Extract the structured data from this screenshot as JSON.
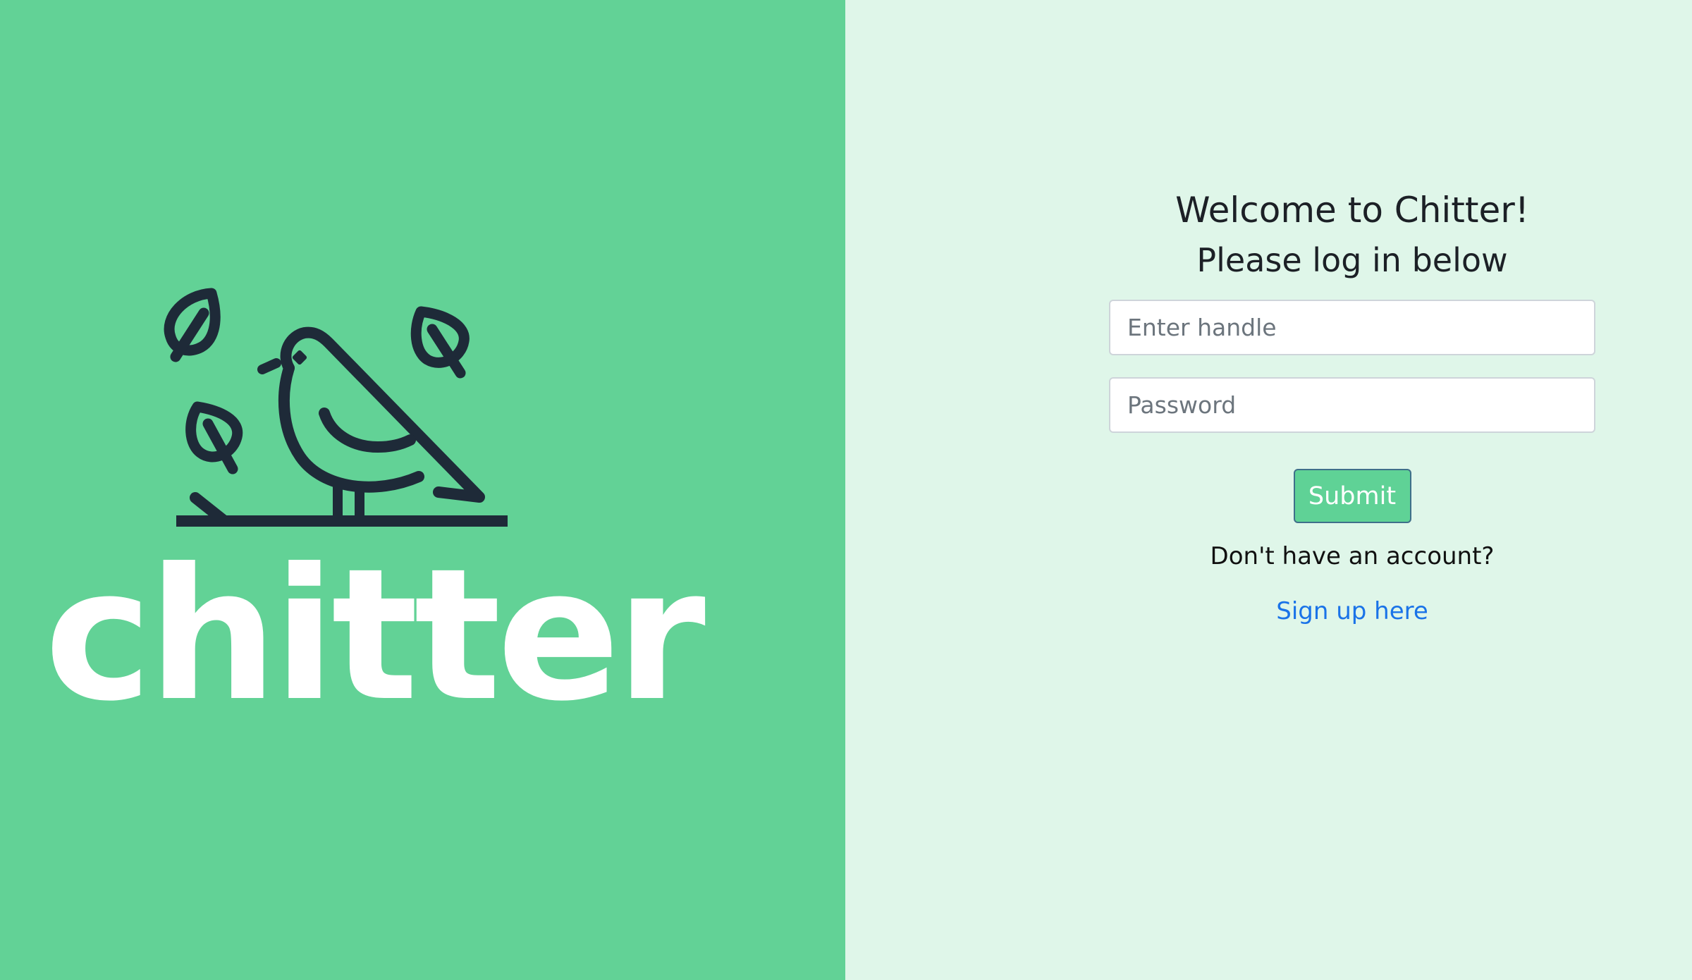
{
  "brand": {
    "wordmark": "chitter",
    "logo_icon": "bird-on-branch-with-leaves",
    "panel_color": "#62d296",
    "ink_color": "#1e2a38"
  },
  "login": {
    "title": "Welcome to Chitter!",
    "subtitle": "Please log in below",
    "handle_field": {
      "placeholder": "Enter handle",
      "value": ""
    },
    "password_field": {
      "placeholder": "Password",
      "value": ""
    },
    "submit_label": "Submit",
    "no_account_text": "Don't have an account?",
    "signup_link_label": "Sign up here",
    "accent_color": "#5fd296",
    "link_color": "#1a73e8",
    "background_color": "#dff6e9"
  }
}
